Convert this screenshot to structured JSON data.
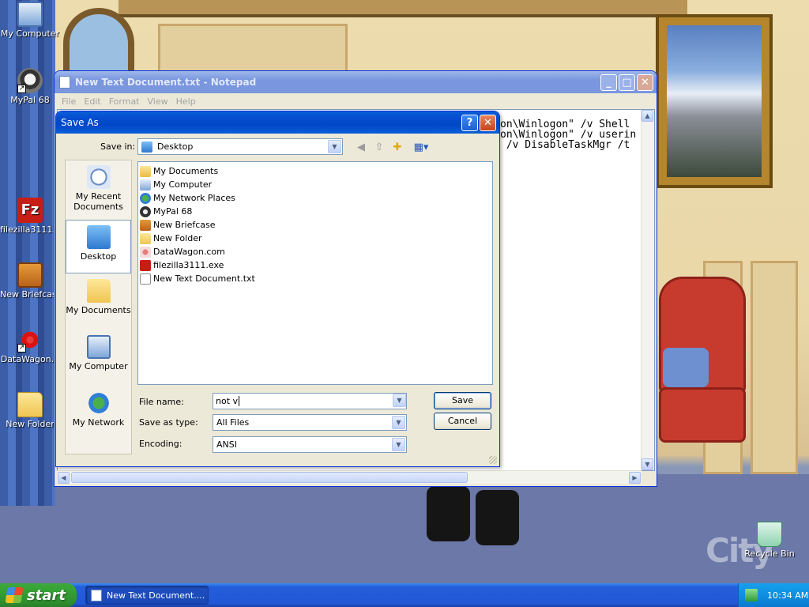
{
  "desktop": {
    "icons": [
      {
        "label": "My Computer"
      },
      {
        "label": "MyPal 68"
      },
      {
        "label": "filezilla3111..."
      },
      {
        "label": "New Briefcase"
      },
      {
        "label": "DataWagon..."
      },
      {
        "label": "New Folder"
      },
      {
        "label": "Recycle Bin"
      }
    ],
    "watermark": "City"
  },
  "notepad": {
    "title": "New Text Document.txt - Notepad",
    "menu": [
      "File",
      "Edit",
      "Format",
      "View",
      "Help"
    ],
    "lines": [
      "on\\Winlogon\" /v Shell",
      "on\\Winlogon\" /v userin",
      " /v DisableTaskMgr /t"
    ]
  },
  "dialog": {
    "title": "Save As",
    "save_in_label": "Save in:",
    "save_in_value": "Desktop",
    "places": [
      {
        "label": "My Recent Documents"
      },
      {
        "label": "Desktop"
      },
      {
        "label": "My Documents"
      },
      {
        "label": "My Computer"
      },
      {
        "label": "My Network"
      }
    ],
    "files": [
      {
        "name": "My Documents"
      },
      {
        "name": "My Computer"
      },
      {
        "name": "My Network Places"
      },
      {
        "name": "MyPal 68"
      },
      {
        "name": "New Briefcase"
      },
      {
        "name": "New Folder"
      },
      {
        "name": "DataWagon.com"
      },
      {
        "name": "filezilla3111.exe"
      },
      {
        "name": "New Text Document.txt"
      }
    ],
    "file_name_label": "File name:",
    "file_name_value": "not v",
    "save_as_type_label": "Save as type:",
    "save_as_type_value": "All Files",
    "encoding_label": "Encoding:",
    "encoding_value": "ANSI",
    "save_button": "Save",
    "cancel_button": "Cancel"
  },
  "taskbar": {
    "start_label": "start",
    "task_label": "New Text Document....",
    "clock": "10:34 AM"
  }
}
